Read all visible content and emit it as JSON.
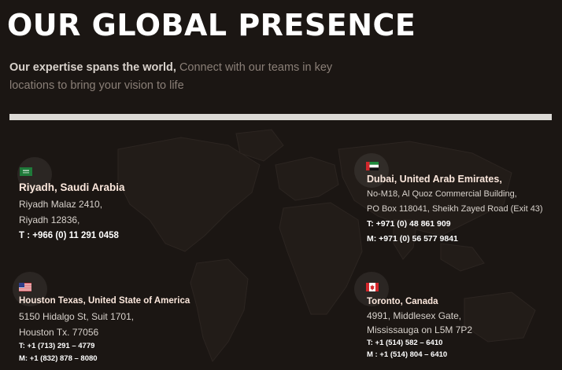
{
  "header": {
    "title": "OUR GLOBAL PRESENCE",
    "subtitle_lead": "Our expertise spans the world,",
    "subtitle_rest": " Connect with our teams in key locations to bring your vision to life"
  },
  "offices": {
    "riyadh": {
      "flag": "saudi-arabia-flag-icon",
      "name": "Riyadh, Saudi Arabia",
      "address_1": "Riyadh Malaz 2410,",
      "address_2": "Riyadh 12836,",
      "phone": "T : +966 (0) 11 291 0458"
    },
    "dubai": {
      "flag": "uae-flag-icon",
      "name": "Dubai, United Arab Emirates,",
      "address_1": "No-M18, Al Quoz Commercial Building,",
      "address_2": "PO Box 118041, Sheikh Zayed Road (Exit 43)",
      "phone": "T: +971 (0) 48 861 909",
      "mobile": "M: +971 (0) 56 577 9841"
    },
    "houston": {
      "flag": "usa-flag-icon",
      "name": "Houston Texas, United State of America",
      "address_1": "5150 Hidalgo St, Suit 1701,",
      "address_2": "Houston Tx. 77056",
      "phone": "T: +1 (713) 291 – 4779",
      "mobile": "M: +1 (832) 878 – 8080"
    },
    "toronto": {
      "flag": "canada-flag-icon",
      "name": "Toronto, Canada",
      "address_1": "4991, Middlesex Gate,",
      "address_2": "Mississauga on L5M 7P2",
      "phone": "T: +1 (514) 582 – 6410",
      "mobile": "M : +1 (514) 804 – 6410"
    }
  },
  "colors": {
    "background": "#1b1613",
    "heading": "#ffffff",
    "divider": "#dcdad6",
    "office_name": "#fbe7dc"
  }
}
